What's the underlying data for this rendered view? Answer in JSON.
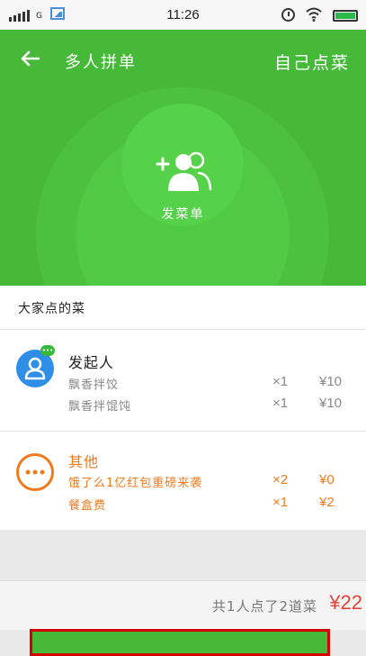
{
  "statusbar": {
    "network": "G",
    "time": "11:26"
  },
  "header": {
    "title": "多人拼单",
    "self_order": "自己点菜",
    "launch_label": "发菜单"
  },
  "list": {
    "section_title": "大家点的菜",
    "groups": [
      {
        "name": "发起人",
        "icon": "person-icon",
        "color": "#2f8fe6",
        "items": [
          {
            "dish": "飘香拌饺",
            "qty": "×1",
            "price": "¥10"
          },
          {
            "dish": "飘香拌馄饨",
            "qty": "×1",
            "price": "¥10"
          }
        ]
      },
      {
        "name": "其他",
        "icon": "more-icon",
        "color": "#ef7a1e",
        "items": [
          {
            "dish": "饿了么1亿红包重磅来袭",
            "qty": "×2",
            "price": "¥0"
          },
          {
            "dish": "餐盒费",
            "qty": "×1",
            "price": "¥2"
          }
        ]
      }
    ]
  },
  "footer": {
    "summary": "共1人点了2道菜",
    "total": "¥22"
  },
  "submit": {
    "label": ""
  },
  "colors": {
    "brand_green": "#46b939",
    "accent_orange": "#ef7a1e",
    "price_red": "#e0453a"
  }
}
